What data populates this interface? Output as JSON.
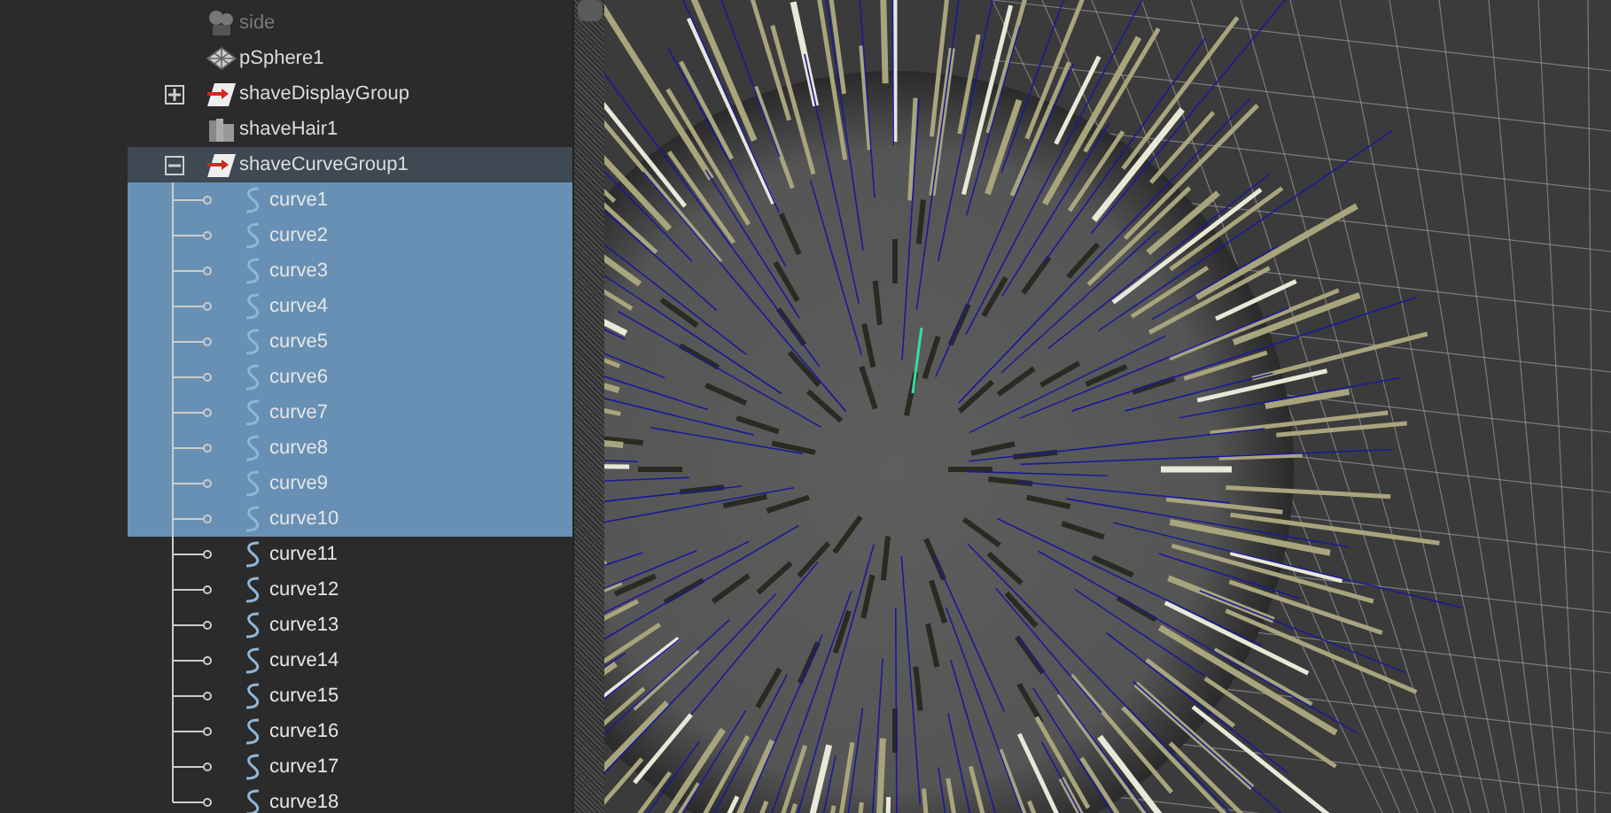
{
  "outliner": {
    "items": [
      {
        "label": "side",
        "kind": "camera",
        "dimmed": true,
        "highlighted": false
      },
      {
        "label": "pSphere1",
        "kind": "mesh",
        "dimmed": false,
        "highlighted": false
      },
      {
        "label": "shaveDisplayGroup",
        "kind": "group",
        "dimmed": false,
        "highlighted": false,
        "expanded": false
      },
      {
        "label": "shaveHair1",
        "kind": "hair",
        "dimmed": false,
        "highlighted": false
      },
      {
        "label": "shaveCurveGroup1",
        "kind": "group",
        "dimmed": false,
        "highlighted": true,
        "expanded": true,
        "children": [
          {
            "label": "curve1",
            "selected": true
          },
          {
            "label": "curve2",
            "selected": true
          },
          {
            "label": "curve3",
            "selected": true
          },
          {
            "label": "curve4",
            "selected": true
          },
          {
            "label": "curve5",
            "selected": true
          },
          {
            "label": "curve6",
            "selected": true
          },
          {
            "label": "curve7",
            "selected": true
          },
          {
            "label": "curve8",
            "selected": true
          },
          {
            "label": "curve9",
            "selected": true
          },
          {
            "label": "curve10",
            "selected": true
          },
          {
            "label": "curve11",
            "selected": false
          },
          {
            "label": "curve12",
            "selected": false
          },
          {
            "label": "curve13",
            "selected": false
          },
          {
            "label": "curve14",
            "selected": false
          },
          {
            "label": "curve15",
            "selected": false
          },
          {
            "label": "curve16",
            "selected": false
          },
          {
            "label": "curve17",
            "selected": false
          },
          {
            "label": "curve18",
            "selected": false
          }
        ]
      }
    ]
  }
}
